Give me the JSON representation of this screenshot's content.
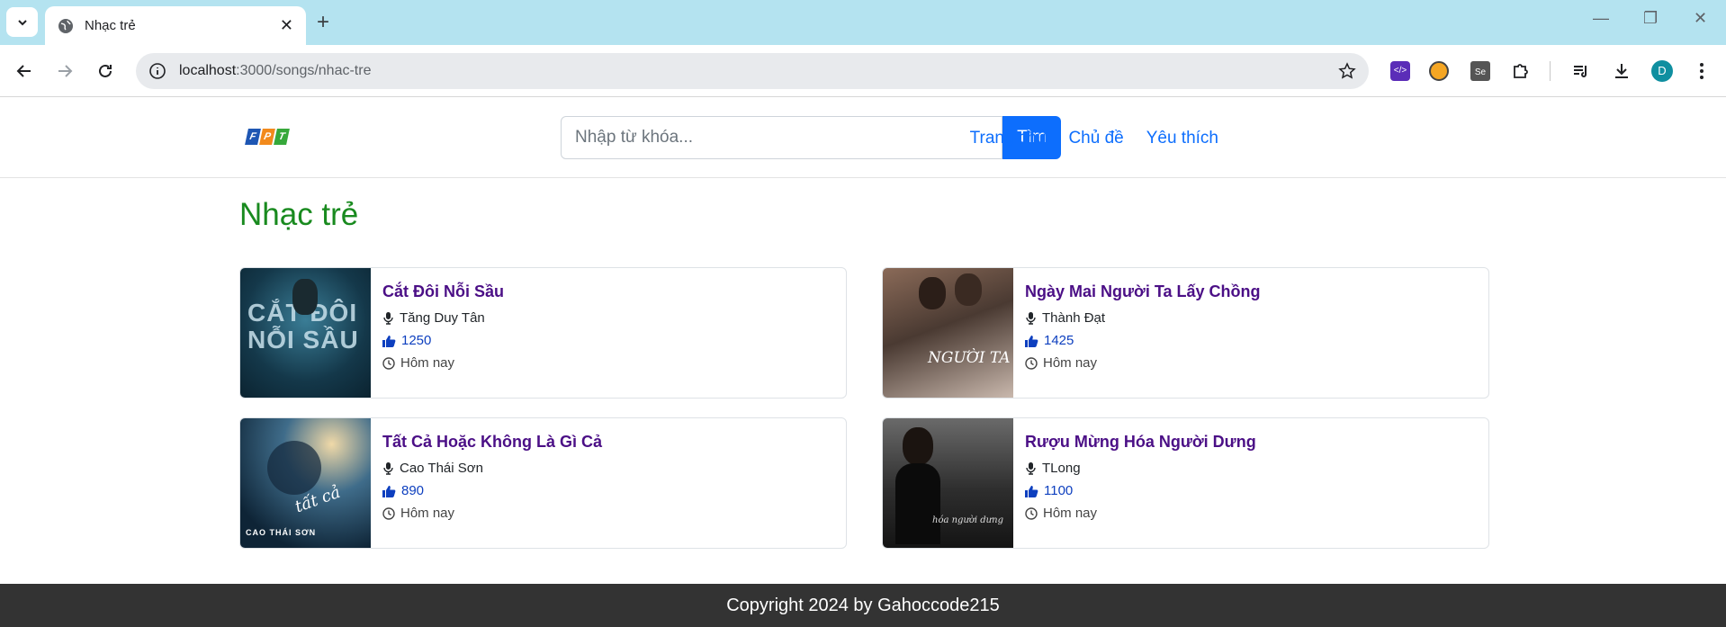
{
  "browser": {
    "tab_title": "Nhạc trẻ",
    "url_host": "localhost",
    "url_path": ":3000/songs/nhac-tre",
    "profile_initial": "D"
  },
  "header": {
    "logo_letters": [
      "F",
      "P",
      "T"
    ],
    "search_placeholder": "Nhập từ khóa...",
    "search_button": "Tìm",
    "nav": [
      "Trang chủ",
      "Chủ đề",
      "Yêu thích"
    ]
  },
  "main": {
    "title": "Nhạc trẻ",
    "songs": [
      {
        "title": "Cắt Đôi Nỗi Sầu",
        "artist": "Tăng Duy Tân",
        "likes": "1250",
        "time": "Hôm nay"
      },
      {
        "title": "Ngày Mai Người Ta Lấy Chồng",
        "artist": "Thành Đạt",
        "likes": "1425",
        "time": "Hôm nay"
      },
      {
        "title": "Tất Cả Hoặc Không Là Gì Cả",
        "artist": "Cao Thái Sơn",
        "likes": "890",
        "time": "Hôm nay"
      },
      {
        "title": "Rượu Mừng Hóa Người Dưng",
        "artist": "TLong",
        "likes": "1100",
        "time": "Hôm nay"
      }
    ]
  },
  "footer": {
    "text": "Copyright 2024 by Gahoccode215"
  },
  "colors": {
    "accent": "#0d6efd",
    "title_green": "#198a1f",
    "song_title": "#4b0f86",
    "footer_bg": "#333333"
  }
}
